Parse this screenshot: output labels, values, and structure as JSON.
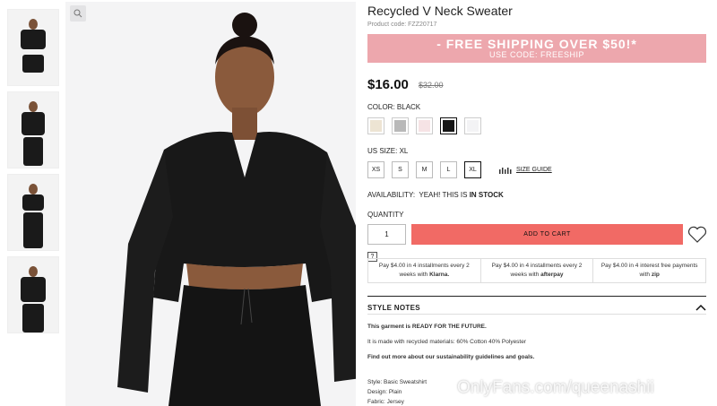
{
  "product": {
    "title": "Recycled V Neck Sweater",
    "code": "Product code: FZZ20717",
    "price": "$16.00",
    "old_price": "$32.00"
  },
  "promo": {
    "line1": "- FREE SHIPPING OVER $50!*",
    "line2": "USE CODE: FREESHIP",
    "color": "#eda7ad"
  },
  "color": {
    "label": "COLOR:",
    "selected": "BLACK",
    "swatches": [
      "#ede4d3",
      "#b9b9b9",
      "#f6e3e5",
      "#161616",
      "#f3f3f5"
    ]
  },
  "size": {
    "label": "US SIZE:",
    "selected": "XL",
    "options": [
      "XS",
      "S",
      "M",
      "L",
      "XL"
    ],
    "guide_label": "SIZE GUIDE"
  },
  "availability": {
    "label": "AVAILABILITY:",
    "text": "YEAH! THIS IS",
    "status": "IN STOCK"
  },
  "quantity": {
    "label": "QUANTITY",
    "value": "1"
  },
  "cart": {
    "button_label": "ADD TO CART",
    "color": "#f16a65"
  },
  "help_label": "?",
  "payments": [
    {
      "prefix": "Pay",
      "amount": "$4.00",
      "text": "in 4 installments every 2 weeks with",
      "brand": "Klarna."
    },
    {
      "prefix": "Pay",
      "amount": "$4.00",
      "text": "in 4 installments every 2 weeks with",
      "brand": "afterpay"
    },
    {
      "prefix": "Pay",
      "amount": "$4.00",
      "text": "in 4 interest free payments with",
      "brand": "zip"
    }
  ],
  "style_notes": {
    "title": "STYLE NOTES",
    "line1": "This garment is READY FOR THE FUTURE.",
    "line2": "It is made with recycled materials: 60% Cotton 40% Polyester",
    "line3": "Find out more about our sustainability guidelines and goals.",
    "style": "Style: Basic Sweatshirt",
    "design": "Design: Plain",
    "fabric": "Fabric: Jersey"
  },
  "watermark": "OnlyFans.com/queenashii",
  "icons": {
    "zoom": "magnifier-icon",
    "heart": "heart-icon",
    "size_guide": "ruler-icon",
    "collapse": "chevron-up-icon"
  }
}
